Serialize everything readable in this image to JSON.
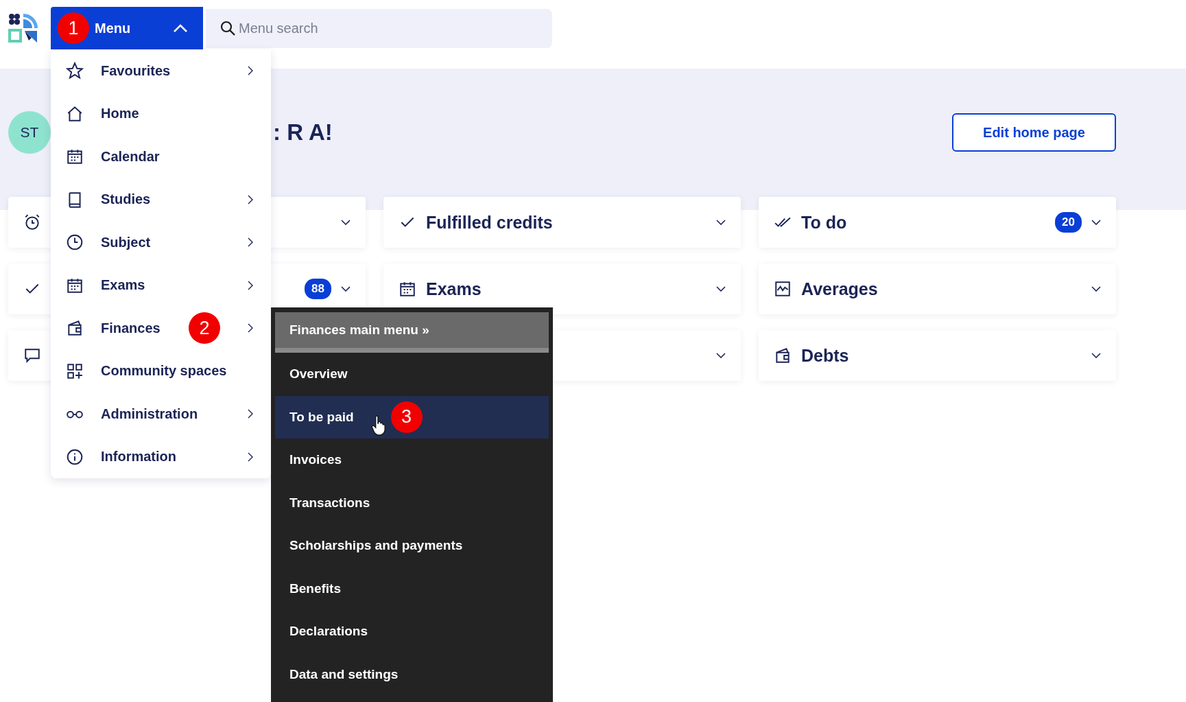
{
  "header": {
    "menu_button": {
      "label": "Menu",
      "expanded": true,
      "step": "1"
    },
    "search": {
      "placeholder": "Menu search"
    }
  },
  "hero": {
    "avatar": "ST",
    "greeting": ": R A!",
    "edit_button": "Edit home page"
  },
  "cards": [
    {
      "chevron": true
    },
    {
      "title": "Fulfilled credits",
      "chevron": true
    },
    {
      "title": "To do",
      "badge": "20",
      "chevron": true
    },
    {
      "badge": "88",
      "chevron": true
    },
    {
      "title": "Exams",
      "chevron": true
    },
    {
      "title": "Averages",
      "chevron": true
    },
    {
      "chevron": false
    },
    {
      "chevron": true
    },
    {
      "title": "Debts",
      "chevron": true
    }
  ],
  "menu": {
    "items": [
      {
        "label": "Favourites",
        "has_submenu": true
      },
      {
        "label": "Home",
        "has_submenu": false
      },
      {
        "label": "Calendar",
        "has_submenu": false
      },
      {
        "label": "Studies",
        "has_submenu": true
      },
      {
        "label": "Subject",
        "has_submenu": true
      },
      {
        "label": "Exams",
        "has_submenu": true
      },
      {
        "label": "Finances",
        "has_submenu": true,
        "step": "2"
      },
      {
        "label": "Community spaces",
        "has_submenu": false
      },
      {
        "label": "Administration",
        "has_submenu": true
      },
      {
        "label": "Information",
        "has_submenu": true
      }
    ]
  },
  "submenu": {
    "header": "Finances main menu »",
    "items": [
      {
        "label": "Overview",
        "selected": false
      },
      {
        "label": "To be paid",
        "selected": true,
        "step": "3"
      },
      {
        "label": "Invoices",
        "selected": false
      },
      {
        "label": "Transactions",
        "selected": false
      },
      {
        "label": "Scholarships and payments",
        "selected": false
      },
      {
        "label": "Benefits",
        "selected": false
      },
      {
        "label": "Declarations",
        "selected": false
      },
      {
        "label": "Data and settings",
        "selected": false
      }
    ]
  }
}
